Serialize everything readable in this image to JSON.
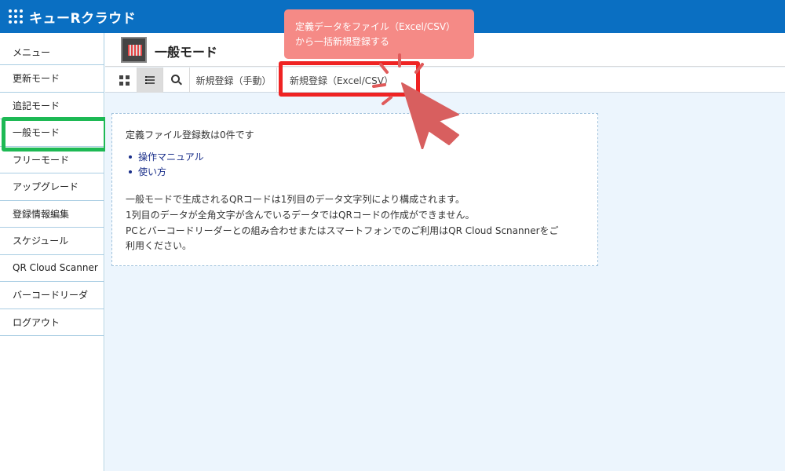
{
  "header": {
    "app_title": "キューRクラウド"
  },
  "sidebar": {
    "items": [
      {
        "label": "メニュー",
        "icon": ""
      },
      {
        "label": "更新モード"
      },
      {
        "label": "追記モード"
      },
      {
        "label": "一般モード",
        "selected": true
      },
      {
        "label": "フリーモード"
      },
      {
        "label": "アップグレード"
      },
      {
        "label": "登録情報編集"
      },
      {
        "label": "スケジュール"
      },
      {
        "label": "QR Cloud Scanner"
      },
      {
        "label": "バーコードリーダ"
      },
      {
        "label": "ログアウト"
      }
    ]
  },
  "page": {
    "title": "一般モード",
    "mode_icon": "barcode-mode-icon"
  },
  "toolbar": {
    "grid_view_icon": "grid-icon",
    "list_view_icon": "list-icon",
    "search_icon": "search-icon",
    "new_manual_label": "新規登録（手動）",
    "new_excel_label": "新規登録（Excel/CSV）"
  },
  "info": {
    "heading": "定義ファイル登録数は0件です",
    "links": [
      "操作マニュアル",
      "使い方"
    ],
    "notes": [
      "一般モードで生成されるQRコードは1列目のデータ文字列により構成されます。",
      "1列目のデータが全角文字が含んでいるデータではQRコードの作成ができません。",
      "PCとバーコードリーダーとの組み合わせまたはスマートフォンでのご利用はQR Cloud Scnannerをご",
      "利用ください。"
    ]
  },
  "annotation": {
    "tooltip_lines": [
      "定義データをファイル（Excel/CSV）",
      "から一括新規登録する"
    ],
    "highlight_color": "#ef2323",
    "sidebar_highlight_color": "#1db954",
    "tooltip_color": "#f58a86"
  },
  "colors": {
    "brand": "#0a6fc2",
    "content_bg": "#ecf5fd",
    "border": "#a9cde3",
    "link": "#1a2f8a"
  }
}
